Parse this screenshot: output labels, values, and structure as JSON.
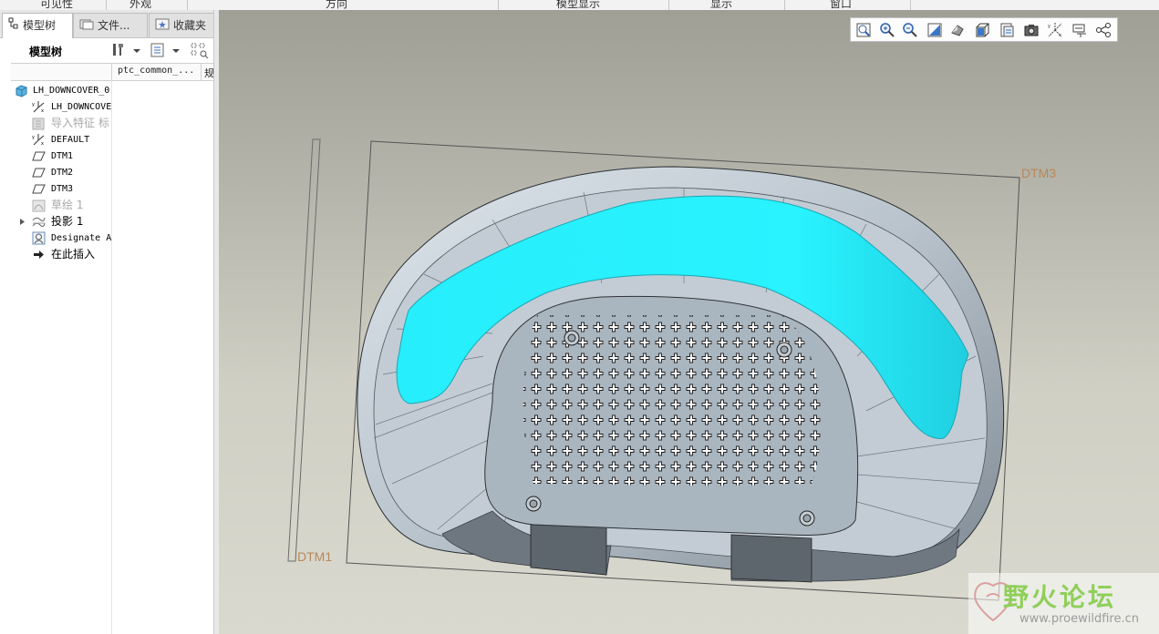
{
  "menubar": {
    "items": [
      "可见性",
      "外观",
      "方向",
      "模型显示",
      "显示",
      "窗口"
    ]
  },
  "tabs": [
    {
      "label": "模型树",
      "icon": "model-tree-icon",
      "active": true
    },
    {
      "label": "文件...",
      "icon": "folder-icon",
      "active": false
    },
    {
      "label": "收藏夹",
      "icon": "favorites-icon",
      "active": false
    }
  ],
  "tree": {
    "title": "模型树",
    "columns": [
      "ptc_common_...",
      "规"
    ],
    "nodes": [
      {
        "label": "LH_DOWNCOVER_0",
        "icon": "part-icon",
        "dim": false
      },
      {
        "label": "LH_DOWNCOVE",
        "icon": "csys-icon",
        "dim": false
      },
      {
        "label": "导入特征 标",
        "icon": "import-feature-icon",
        "dim": true
      },
      {
        "label": "DEFAULT",
        "icon": "csys-icon",
        "dim": false
      },
      {
        "label": "DTM1",
        "icon": "datum-plane-icon",
        "dim": false
      },
      {
        "label": "DTM2",
        "icon": "datum-plane-icon",
        "dim": false
      },
      {
        "label": "DTM3",
        "icon": "datum-plane-icon",
        "dim": false
      },
      {
        "label": "草绘 1",
        "icon": "sketch-icon",
        "dim": true
      },
      {
        "label": "投影 1",
        "icon": "projection-icon",
        "dim": false
      },
      {
        "label": "Designate A",
        "icon": "designate-icon",
        "dim": false
      },
      {
        "label": "在此插入",
        "icon": "insert-here-arrow-icon",
        "dim": false
      }
    ]
  },
  "viewport": {
    "datum_labels": [
      "DTM3",
      "DTM1"
    ],
    "colors": {
      "highlight": "#22f0ff",
      "datum": "#b8875a",
      "part": "#bcc6cf"
    }
  },
  "view_toolbar": {
    "icons": [
      "refit-icon",
      "zoom-in-icon",
      "zoom-out-icon",
      "repaint-icon",
      "shading-icon",
      "saved-views-icon",
      "view-manager-icon",
      "camera-icon",
      "datum-display-icon",
      "annotation-display-icon",
      "spin-center-icon"
    ]
  },
  "watermark": {
    "text": "野火论坛",
    "url": "www.proewildfire.cn"
  }
}
